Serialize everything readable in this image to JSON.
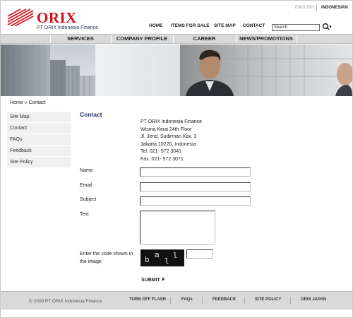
{
  "header": {
    "logo_text": "ORIX",
    "company": "PT ORIX Indonesia Finance",
    "lang_english": "ENGLISH",
    "lang_indonesian": "INDONESIAN",
    "nav": [
      "HOME",
      "ITEMS FOR SALE",
      "SITE MAP",
      "CONTACT"
    ],
    "search_value": "Search",
    "search_icon": "search-icon"
  },
  "main_nav": [
    "SERVICES",
    "COMPANY PROFILE",
    "CAREER",
    "NEWS/PROMOTIONS"
  ],
  "breadcrumb": "Home » Contact",
  "sidebar": [
    "Site Map",
    "Contact",
    "FAQs",
    "Feedback",
    "Site Policy"
  ],
  "content": {
    "title": "Contact",
    "address": [
      "PT ORIX Indonesia Finance",
      "Wisma Keiai 24th Floor",
      "Jl. Jend. Sudirman Kav. 3",
      "Jakarta 10220, Indonesia",
      "Tel. 021- 572 3041",
      "Fax. 021- 572 3071"
    ],
    "labels": {
      "name": "Name",
      "email": "Email",
      "subject": "Subject",
      "text": "Text",
      "code": "Enter the code shown in the image"
    },
    "captcha_chars": [
      "b",
      "a",
      "l",
      "l"
    ],
    "submit": "SUBMIT"
  },
  "footer": {
    "copyright": "© 2009 PT ORIX Indonesia Finance",
    "links": [
      "TURN OFF FLASH",
      "FAQs",
      "FEEDBACK",
      "SITE POLICY",
      "ORIX JAPAN"
    ]
  },
  "colors": {
    "brand_red": "#d0101c",
    "brand_navy": "#1f2a5c",
    "nav_gray": "#d9d9d9"
  }
}
